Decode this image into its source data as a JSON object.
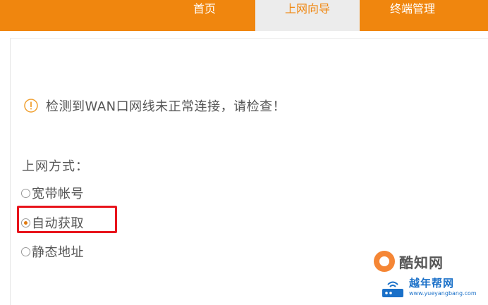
{
  "nav": {
    "tabs": [
      {
        "label": "首页",
        "active": false
      },
      {
        "label": "上网向导",
        "active": true
      },
      {
        "label": "终端管理",
        "active": false
      }
    ]
  },
  "warning": {
    "icon": "warning-circle-icon",
    "text": "检测到WAN口网线未正常连接，请检查！"
  },
  "connection": {
    "label": "上网方式：",
    "options": [
      {
        "label": "宽带帐号",
        "checked": false
      },
      {
        "label": "自动获取",
        "checked": true
      },
      {
        "label": "静态地址",
        "checked": false
      }
    ]
  },
  "watermarks": {
    "site1": "酷知网",
    "site2_title": "越年帮网",
    "site2_url": "www.yueyangbang.com"
  },
  "colors": {
    "brand_orange": "#f0860e",
    "highlight_red": "#e8141c",
    "text_gray": "#555555"
  }
}
